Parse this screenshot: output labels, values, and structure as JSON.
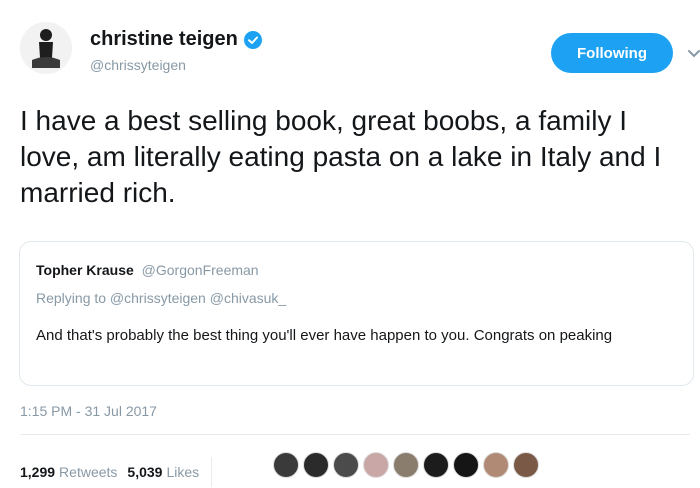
{
  "author": {
    "display_name": "christine teigen",
    "handle": "@chrissyteigen",
    "verified_icon": "verified-badge-icon",
    "follow_label": "Following",
    "menu_icon": "chevron-down-icon"
  },
  "tweet": {
    "text": "I have a best selling book, great boobs, a family I love, am literally eating pasta on a lake in Italy and I married rich."
  },
  "quote": {
    "name": "Topher Krause",
    "handle": "@GorgonFreeman",
    "replying": "Replying to @chrissyteigen @chivasuk_",
    "text": "And that's probably the best thing you'll ever have happen to you. Congrats on peaking"
  },
  "timestamp": "1:15 PM - 31 Jul 2017",
  "stats": {
    "retweets_count": "1,299",
    "retweets_label": "Retweets",
    "likes_count": "5,039",
    "likes_label": "Likes"
  },
  "likers": [
    {
      "color": "#3a3a3a"
    },
    {
      "color": "#2b2b2b"
    },
    {
      "color": "#4b4b4b"
    },
    {
      "color": "#c9a7a7"
    },
    {
      "color": "#8a7d6e"
    },
    {
      "color": "#1c1c1c"
    },
    {
      "color": "#151515"
    },
    {
      "color": "#b08a74"
    },
    {
      "color": "#7a5a46"
    }
  ],
  "colors": {
    "accent": "#1da1f2",
    "secondary_text": "#8899a6",
    "primary_text": "#14171a"
  }
}
